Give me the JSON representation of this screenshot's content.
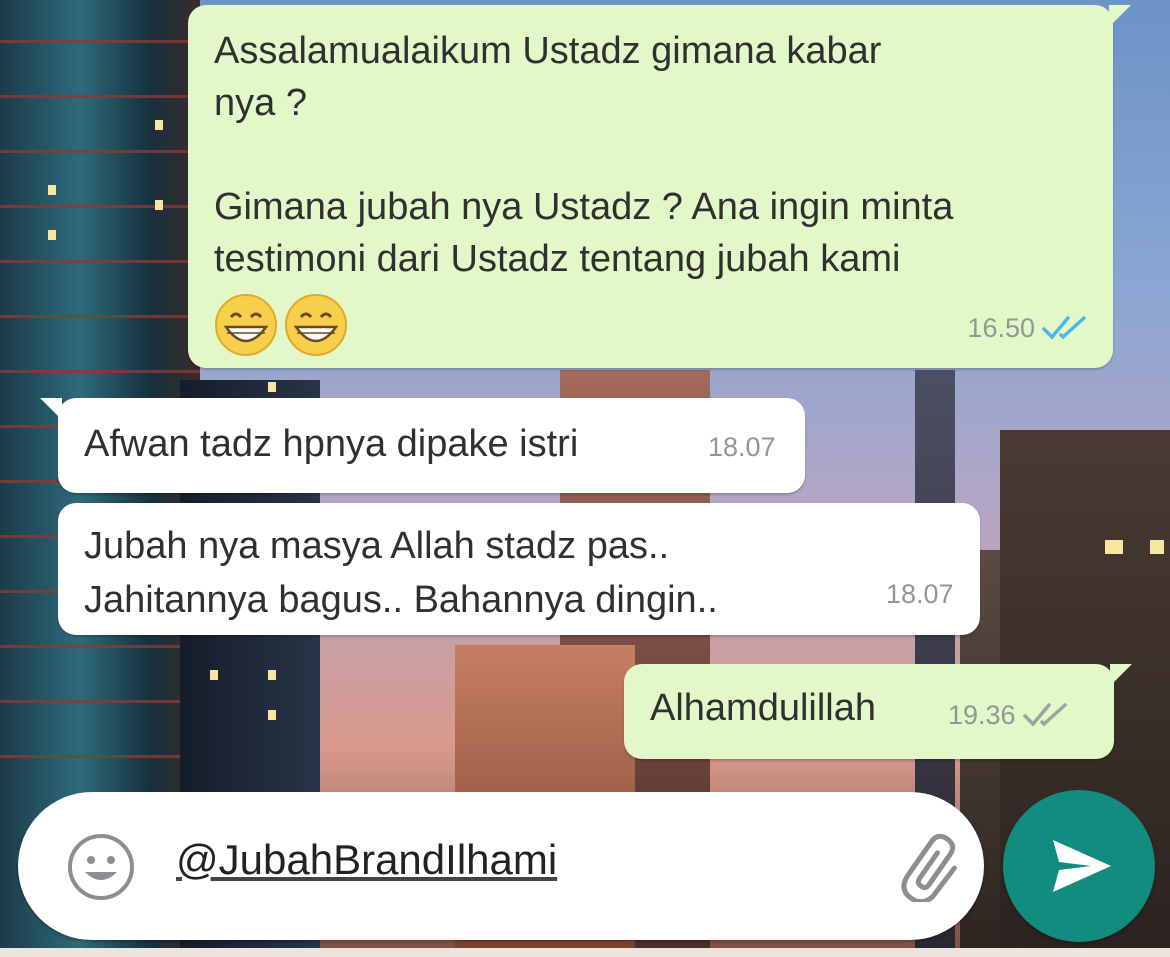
{
  "messages": [
    {
      "id": "msg1",
      "direction": "outgoing",
      "text": "Assalamualaikum Ustadz gimana kabar\nnya ?\n\nGimana jubah nya Ustadz ? Ana ingin minta\ntestimoni dari Ustadz tentang jubah kami",
      "emojis": [
        "grinning-face",
        "grinning-face"
      ],
      "time": "16.50",
      "status": "read"
    },
    {
      "id": "msg2",
      "direction": "incoming",
      "text": "Afwan tadz hpnya dipake istri",
      "time": "18.07"
    },
    {
      "id": "msg3",
      "direction": "incoming",
      "text": "Jubah nya masya Allah stadz pas..\nJahitannya bagus.. Bahannya dingin..",
      "time": "18.07"
    },
    {
      "id": "msg4",
      "direction": "outgoing",
      "text": "Alhamdulillah",
      "time": "19.36",
      "status": "delivered"
    }
  ],
  "composer": {
    "value": "@JubahBrandIlhami",
    "emoji_icon": "smiley-icon",
    "attach_icon": "paperclip-icon",
    "send_icon": "send-arrow-icon"
  },
  "colors": {
    "outgoing_bubble": "#e2f8c8",
    "incoming_bubble": "#ffffff",
    "read_ticks": "#4fb6ec",
    "delivered_ticks": "#9aa5a1",
    "send_button": "#128c7e"
  }
}
